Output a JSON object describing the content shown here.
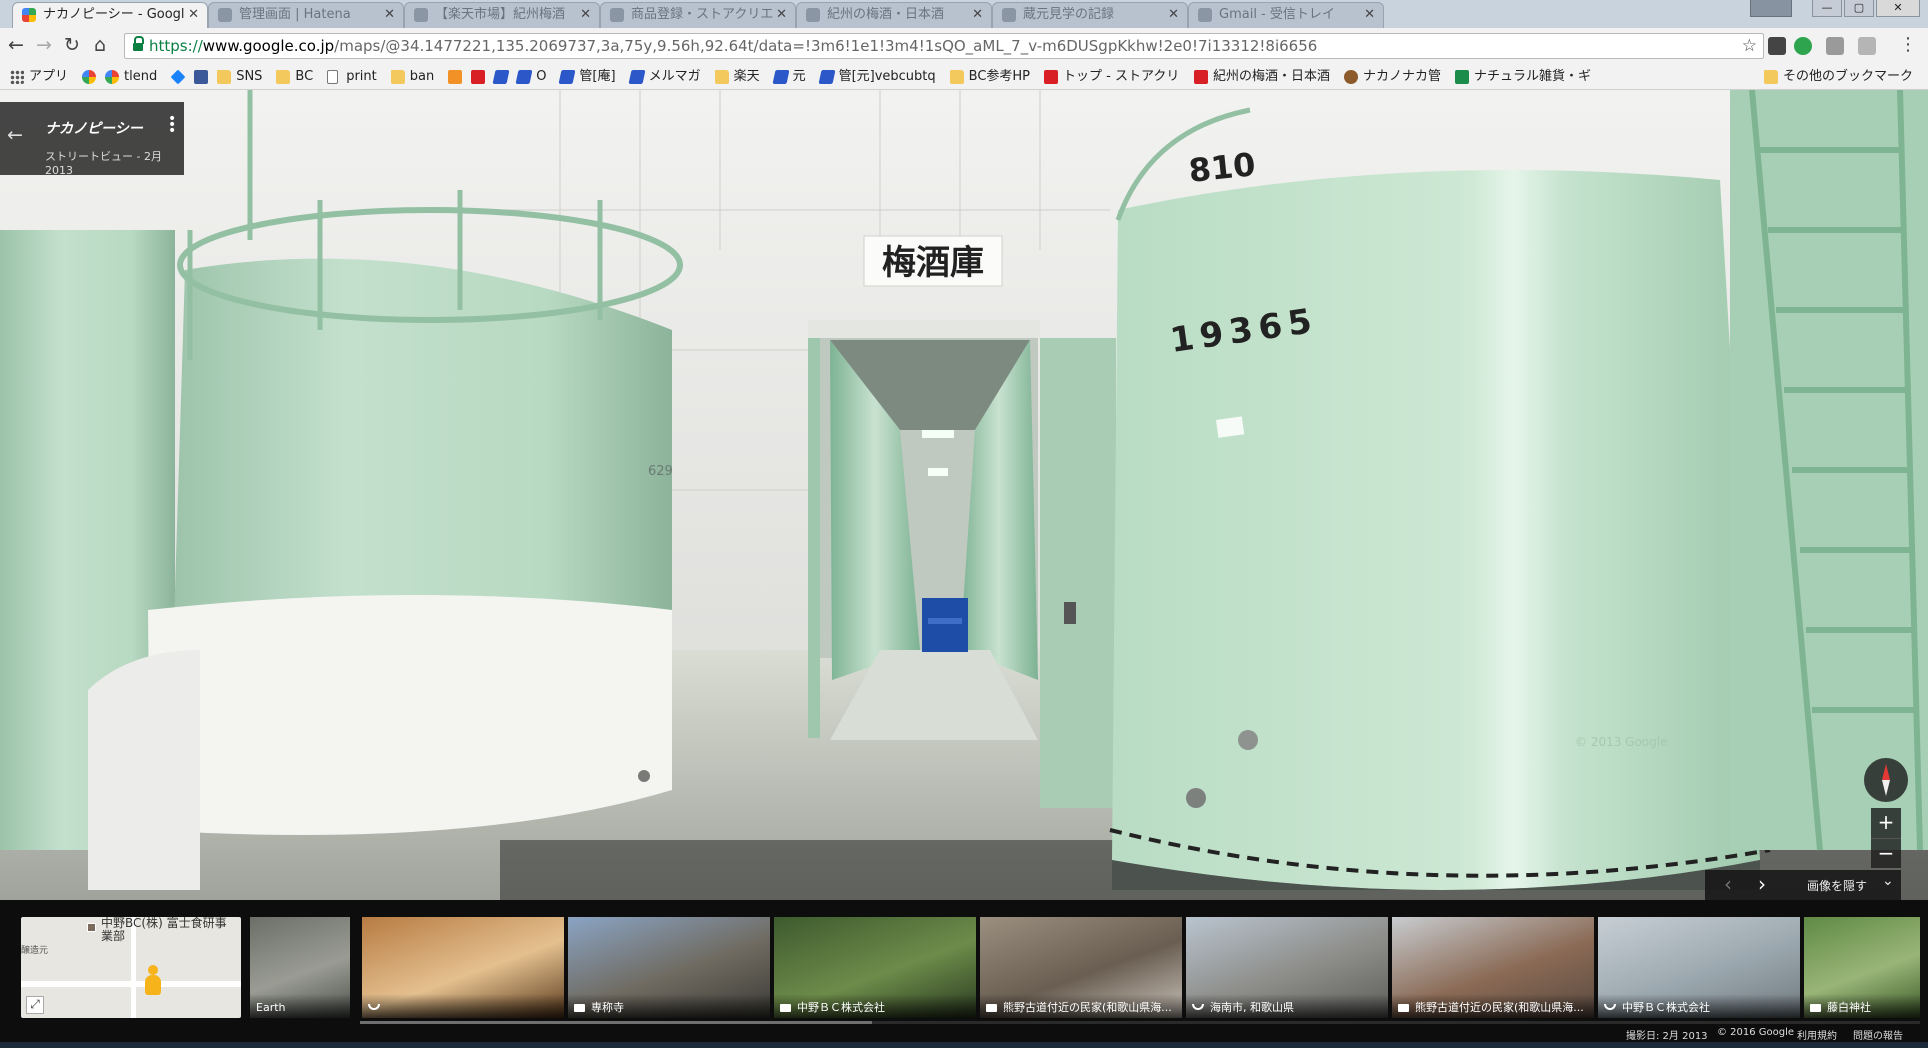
{
  "browser": {
    "tabs": [
      {
        "title": "ナカノピーシー - Googl",
        "active": true
      },
      {
        "title": "管理画面 | Hatena",
        "active": false
      },
      {
        "title": "【楽天市場】紀州梅酒",
        "active": false
      },
      {
        "title": "商品登録・ストアクリエ",
        "active": false
      },
      {
        "title": "紀州の梅酒・日本酒",
        "active": false
      },
      {
        "title": "蔵元見学の記録",
        "active": false
      },
      {
        "title": "Gmail - 受信トレイ",
        "active": false
      }
    ],
    "url": {
      "scheme": "https://",
      "host": "www.google.co.jp",
      "path": "/maps/@34.1477221,135.2069737,3a,75y,9.56h,92.64t/data=!3m6!1e1!3m4!1sQO_aML_7_v-m6DUSgpKkhw!2e0!7i13312!8i6656"
    },
    "bookmarks": [
      {
        "label": "アプリ",
        "icon": "apps"
      },
      {
        "label": "",
        "icon": "google"
      },
      {
        "label": "tlend",
        "icon": "google"
      },
      {
        "label": "",
        "icon": "dropbox"
      },
      {
        "label": "",
        "icon": "facebook"
      },
      {
        "label": "SNS",
        "icon": "folder"
      },
      {
        "label": "BC",
        "icon": "folder"
      },
      {
        "label": "print",
        "icon": "page"
      },
      {
        "label": "ban",
        "icon": "folder"
      },
      {
        "label": "",
        "icon": "orange"
      },
      {
        "label": "",
        "icon": "red"
      },
      {
        "label": "",
        "icon": "blue"
      },
      {
        "label": "O",
        "icon": "blue"
      },
      {
        "label": "管[庵]",
        "icon": "blue"
      },
      {
        "label": "メルマガ",
        "icon": "blue"
      },
      {
        "label": "楽天",
        "icon": "folder"
      },
      {
        "label": "元",
        "icon": "blue"
      },
      {
        "label": "管[元]vebcubtq",
        "icon": "blue"
      },
      {
        "label": "BC参考HP",
        "icon": "folder"
      },
      {
        "label": "トップ - ストアクリ",
        "icon": "red"
      },
      {
        "label": "紀州の梅酒・日本酒",
        "icon": "red"
      },
      {
        "label": "ナカノナカ管",
        "icon": "brown"
      },
      {
        "label": "ナチュラル雑貨・ギ",
        "icon": "green"
      }
    ],
    "other_bookmarks": "その他のブックマーク",
    "window_controls": [
      "—",
      "▢",
      "✕"
    ]
  },
  "streetview": {
    "place_title": "ナカノピーシー",
    "place_subtitle": "ストリートビュー - 2月 2013",
    "sign_text": "梅酒庫",
    "tank_number_top": "810",
    "tank_number_main": "19365",
    "tank_number_left": "629",
    "watermark": "© 2013 Google",
    "zoom_in": "+",
    "zoom_out": "−",
    "compass_icon": "compass-icon"
  },
  "photo_strip": {
    "hide_label": "画像を隠す",
    "minimap_label": "中野BC(株) 富士食研事業部",
    "minimap_side_label": "醸造元",
    "thumbnails": [
      {
        "caption": "Earth",
        "kind": "none",
        "colors": [
          "#6b6f68",
          "#9a9c94",
          "#4d524c"
        ]
      },
      {
        "caption": "",
        "kind": "pano",
        "colors": [
          "#b77b43",
          "#e4c08f",
          "#5a3a1c"
        ]
      },
      {
        "caption": "専称寺",
        "kind": "photo",
        "colors": [
          "#8aa4c4",
          "#6f6a60",
          "#3a3a35"
        ]
      },
      {
        "caption": "中野ＢＣ株式会社",
        "kind": "photo",
        "colors": [
          "#3d5a2e",
          "#6d8c4a",
          "#2a3a20"
        ]
      },
      {
        "caption": "熊野古道付近の民家(和歌山県海...",
        "kind": "photo",
        "colors": [
          "#9b8f80",
          "#6a5e52",
          "#c9c2b8"
        ]
      },
      {
        "caption": "海南市, 和歌山県",
        "kind": "pano",
        "colors": [
          "#b9c4cf",
          "#8c8c88",
          "#5c5d5a"
        ]
      },
      {
        "caption": "熊野古道付近の民家(和歌山県海...",
        "kind": "photo",
        "colors": [
          "#c8ccd0",
          "#8a6a55",
          "#5a4a40"
        ]
      },
      {
        "caption": "中野ＢＣ株式会社",
        "kind": "pano",
        "colors": [
          "#c7cfd5",
          "#9ba7ae",
          "#707a80"
        ]
      },
      {
        "caption": "藤白神社",
        "kind": "photo",
        "colors": [
          "#5f8a45",
          "#99b577",
          "#3d5a2a"
        ]
      }
    ]
  },
  "footer": {
    "capture_date": "撮影日: 2月 2013",
    "copyright": "© 2016 Google",
    "terms": "利用規約",
    "report": "問題の報告"
  }
}
